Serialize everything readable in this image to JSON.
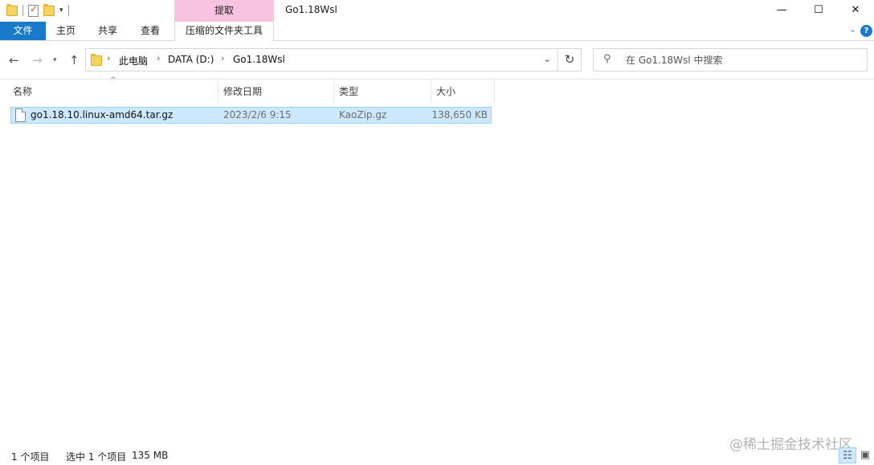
{
  "window": {
    "title": "Go1.18Wsl",
    "context_tab": "提取",
    "controls": {
      "minimize": "—",
      "maximize": "☐",
      "close": "✕"
    }
  },
  "ribbon": {
    "tabs": [
      "文件",
      "主页",
      "共享",
      "查看",
      "压缩的文件夹工具"
    ],
    "expand_icon": "chevron-down",
    "help_icon": "?"
  },
  "nav": {
    "back": "←",
    "forward": "→",
    "recent": "⌄",
    "up": "↑",
    "breadcrumb": [
      "此电脑",
      "DATA (D:)",
      "Go1.18Wsl"
    ],
    "refresh": "↻",
    "search_placeholder": "在 Go1.18Wsl 中搜索"
  },
  "columns": [
    "名称",
    "修改日期",
    "类型",
    "大小"
  ],
  "files": [
    {
      "name": "go1.18.10.linux-amd64.tar.gz",
      "modified": "2023/2/6 9:15",
      "type": "KaoZip.gz",
      "size": "138,650 KB"
    }
  ],
  "status": {
    "item_count": "1 个项目",
    "selected": "选中 1 个项目",
    "selected_size": "135 MB"
  },
  "watermark": "@稀土掘金技术社区",
  "colors": {
    "accent": "#1979ca",
    "context_tab": "#f8c3e0",
    "selection": "#cce8ff",
    "selection_border": "#99d1ff"
  }
}
